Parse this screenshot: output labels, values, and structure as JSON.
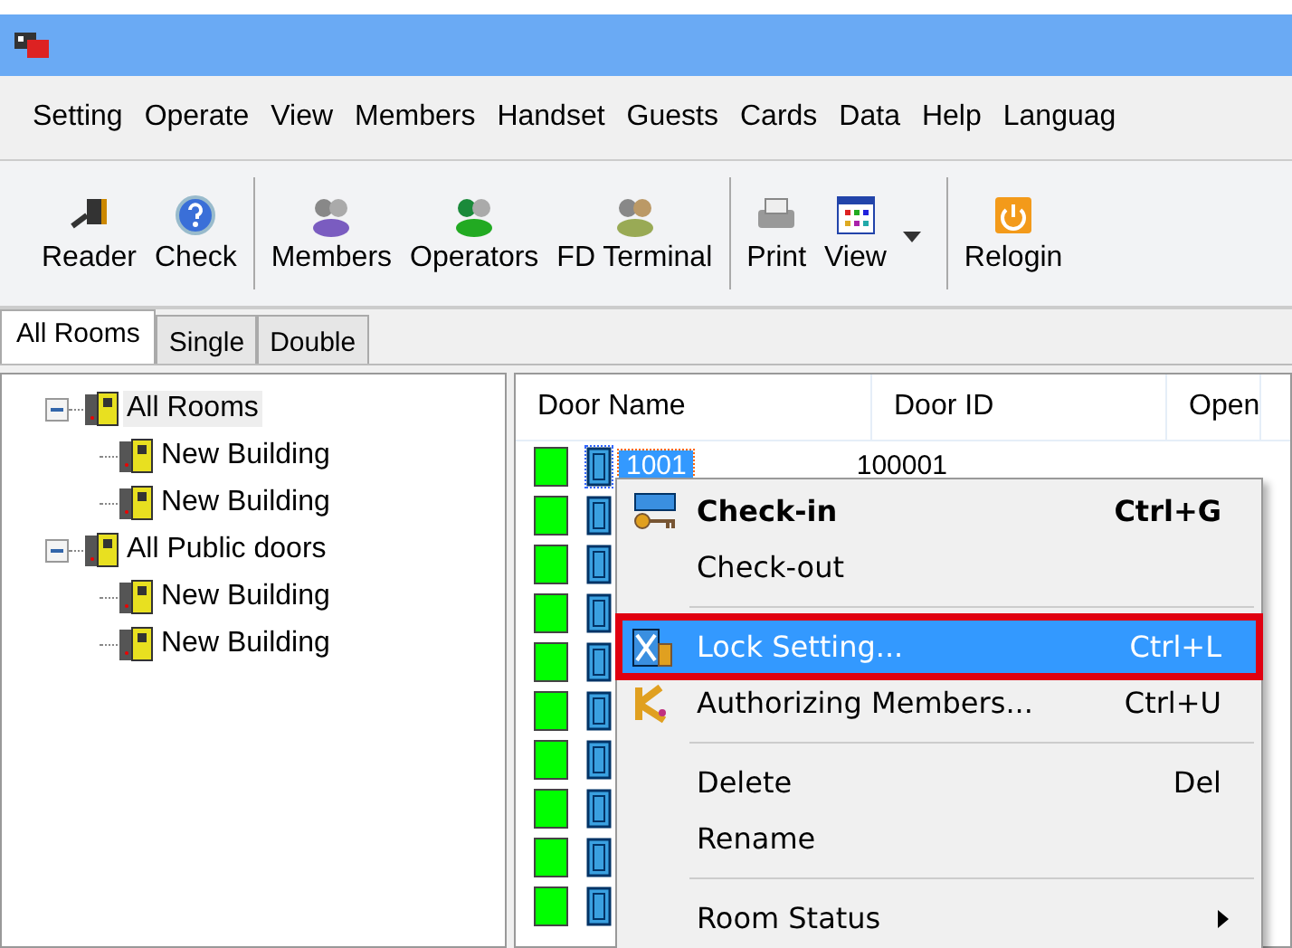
{
  "menu_bar": [
    "Setting",
    "Operate",
    "View",
    "Members",
    "Handset",
    "Guests",
    "Cards",
    "Data",
    "Help",
    "Languag"
  ],
  "toolbar": [
    {
      "kind": "button",
      "label": "Reader"
    },
    {
      "kind": "button",
      "label": "Check"
    },
    {
      "kind": "separator"
    },
    {
      "kind": "button",
      "label": "Members"
    },
    {
      "kind": "button",
      "label": "Operators"
    },
    {
      "kind": "button",
      "label": "FD Terminal"
    },
    {
      "kind": "separator"
    },
    {
      "kind": "button",
      "label": "Print"
    },
    {
      "kind": "button",
      "label": "View"
    },
    {
      "kind": "dropdown"
    },
    {
      "kind": "separator"
    },
    {
      "kind": "button",
      "label": "Relogin"
    }
  ],
  "tabs": [
    {
      "label": "All Rooms",
      "selected": true
    },
    {
      "label": "Single",
      "selected": false
    },
    {
      "label": "Double",
      "selected": false
    }
  ],
  "tree": [
    {
      "label": "All Rooms",
      "expanded": true,
      "selected": true,
      "children": [
        {
          "label": "New Building",
          "selected": false
        },
        {
          "label": "New Building",
          "selected": false
        }
      ]
    },
    {
      "label": "All Public doors",
      "expanded": true,
      "selected": false,
      "children": [
        {
          "label": "New Building",
          "selected": false
        },
        {
          "label": "New Building",
          "selected": false
        }
      ]
    }
  ],
  "table": {
    "columns": [
      "Door Name",
      "Door ID",
      "Open"
    ],
    "rows": [
      {
        "door_name": "1001",
        "door_id": "100001",
        "selected": true,
        "color": "#00ff00"
      },
      {
        "selected": false,
        "color": "#00ff00"
      },
      {
        "selected": false,
        "color": "#00ff00"
      },
      {
        "selected": false,
        "color": "#00ff00"
      },
      {
        "selected": false,
        "color": "#00ff00"
      },
      {
        "selected": false,
        "color": "#00ff00"
      },
      {
        "selected": false,
        "color": "#00ff00"
      },
      {
        "selected": false,
        "color": "#00ff00"
      },
      {
        "selected": false,
        "color": "#00ff00"
      },
      {
        "selected": false,
        "color": "#00ff00"
      }
    ]
  },
  "context_menu": [
    {
      "kind": "item",
      "label": "Check-in",
      "shortcut": "Ctrl+G",
      "default": true,
      "selected": false,
      "highlighted": false,
      "submenu": false
    },
    {
      "kind": "item",
      "label": "Check-out",
      "default": false,
      "selected": false,
      "highlighted": false,
      "submenu": false
    },
    {
      "kind": "separator"
    },
    {
      "kind": "item",
      "label": "Lock Setting...",
      "shortcut": "Ctrl+L",
      "default": false,
      "selected": true,
      "highlighted": true,
      "submenu": false
    },
    {
      "kind": "item",
      "label": "Authorizing Members...",
      "shortcut": "Ctrl+U",
      "default": false,
      "selected": false,
      "highlighted": false,
      "submenu": false
    },
    {
      "kind": "separator"
    },
    {
      "kind": "item",
      "label": "Delete",
      "shortcut": "Del",
      "default": false,
      "selected": false,
      "highlighted": false,
      "submenu": false
    },
    {
      "kind": "item",
      "label": "Rename",
      "default": false,
      "selected": false,
      "highlighted": false,
      "submenu": false
    },
    {
      "kind": "separator"
    },
    {
      "kind": "item",
      "label": "Room Status",
      "default": false,
      "selected": false,
      "highlighted": false,
      "submenu": true
    }
  ]
}
